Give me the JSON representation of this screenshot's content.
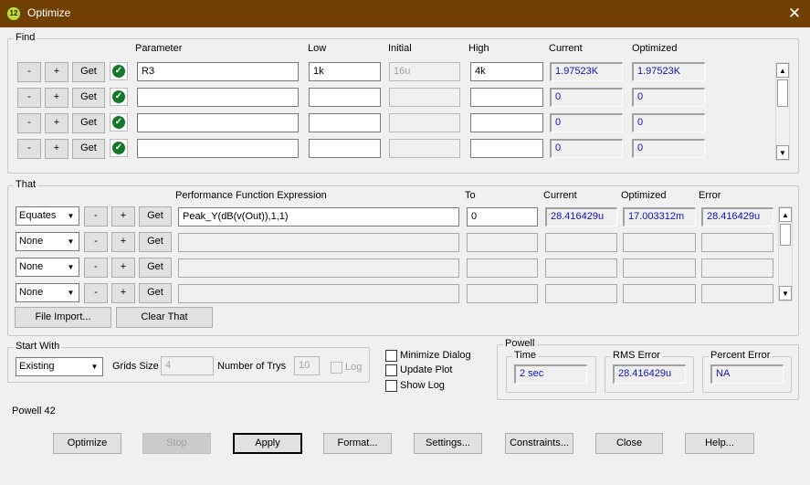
{
  "window": {
    "title": "Optimize",
    "icon": "app-icon",
    "close_glyph": "✕"
  },
  "find": {
    "legend": "Find",
    "headers": {
      "parameter": "Parameter",
      "low": "Low",
      "initial": "Initial",
      "high": "High",
      "current": "Current",
      "optimized": "Optimized"
    },
    "minus": "-",
    "plus": "+",
    "get": "Get",
    "rows": [
      {
        "parameter": "R3",
        "low": "1k",
        "initial": "16u",
        "high": "4k",
        "current": "1.97523K",
        "optimized": "1.97523K"
      },
      {
        "parameter": "",
        "low": "",
        "initial": "",
        "high": "",
        "current": "0",
        "optimized": "0"
      },
      {
        "parameter": "",
        "low": "",
        "initial": "",
        "high": "",
        "current": "0",
        "optimized": "0"
      },
      {
        "parameter": "",
        "low": "",
        "initial": "",
        "high": "",
        "current": "0",
        "optimized": "0"
      }
    ]
  },
  "that": {
    "legend": "That",
    "headers": {
      "expression": "Performance Function Expression",
      "to": "To",
      "current": "Current",
      "optimized": "Optimized",
      "error": "Error"
    },
    "minus": "-",
    "plus": "+",
    "get": "Get",
    "rows": [
      {
        "mode": "Equates",
        "expression": "Peak_Y(dB(v(Out)),1,1)",
        "to": "0",
        "current": "28.416429u",
        "optimized": "17.003312m",
        "error": "28.416429u"
      },
      {
        "mode": "None",
        "expression": "",
        "to": "",
        "current": "",
        "optimized": "",
        "error": ""
      },
      {
        "mode": "None",
        "expression": "",
        "to": "",
        "current": "",
        "optimized": "",
        "error": ""
      },
      {
        "mode": "None",
        "expression": "",
        "to": "",
        "current": "",
        "optimized": "",
        "error": ""
      }
    ],
    "file_import": "File Import...",
    "clear_that": "Clear That"
  },
  "start_with": {
    "legend": "Start With",
    "mode": "Existing",
    "grids_size_label": "Grids Size",
    "grids_size": "4",
    "trys_label": "Number of Trys",
    "trys": "10",
    "log_label": "Log"
  },
  "options": {
    "minimize_dialog": "Minimize Dialog",
    "update_plot": "Update Plot",
    "show_log": "Show Log"
  },
  "powell": {
    "legend": "Powell",
    "time_label": "Time",
    "time": "2 sec",
    "rms_label": "RMS Error",
    "rms": "28.416429u",
    "pct_label": "Percent Error",
    "pct": "NA"
  },
  "status": "Powell 42",
  "buttons": {
    "optimize": "Optimize",
    "stop": "Stop",
    "apply": "Apply",
    "format": "Format...",
    "settings": "Settings...",
    "constraints": "Constraints...",
    "close": "Close",
    "help": "Help..."
  },
  "colors": {
    "titlebar": "#713f00",
    "value_text": "#1010c0",
    "check_green": "#14782a"
  }
}
